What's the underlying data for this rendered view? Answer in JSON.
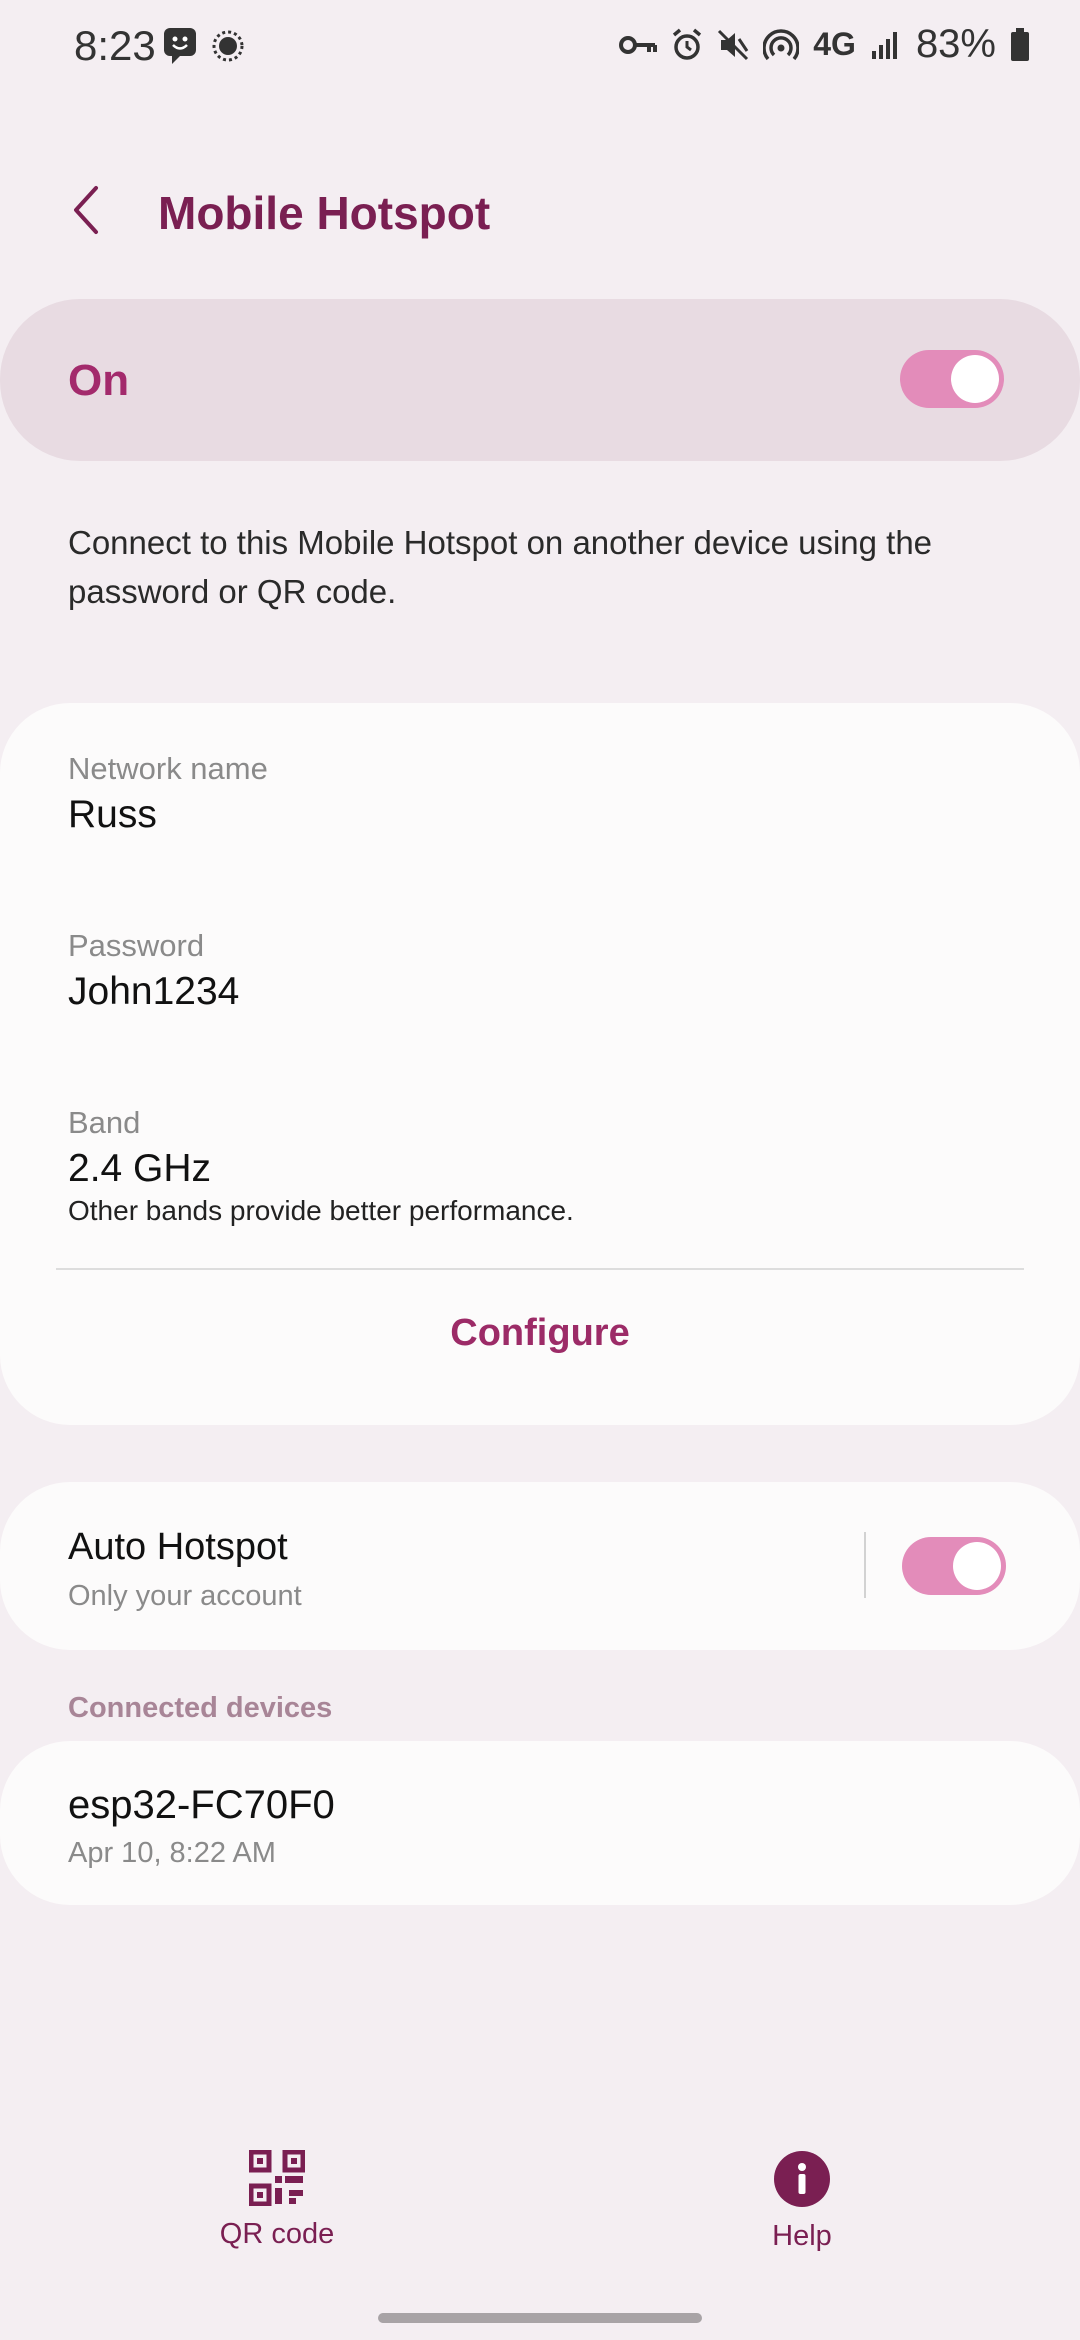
{
  "status_bar": {
    "time": "8:23",
    "network": "4G",
    "battery": "83%"
  },
  "header": {
    "title": "Mobile Hotspot"
  },
  "master_toggle": {
    "label": "On",
    "state": "on"
  },
  "description": "Connect to this Mobile Hotspot on another device using the password or QR code.",
  "network_info": {
    "network_name_label": "Network name",
    "network_name": "Russ",
    "password_label": "Password",
    "password": "John1234",
    "band_label": "Band",
    "band": "2.4 GHz",
    "band_note": "Other bands provide better performance.",
    "configure_label": "Configure"
  },
  "auto_hotspot": {
    "title": "Auto Hotspot",
    "subtitle": "Only your account",
    "state": "on"
  },
  "connected_devices": {
    "header": "Connected devices",
    "items": [
      {
        "name": "esp32-FC70F0",
        "time": "Apr 10, 8:22 AM"
      }
    ]
  },
  "bottom_bar": {
    "qr_label": "QR code",
    "help_label": "Help"
  },
  "colors": {
    "accent": "#7a1f52",
    "toggle_on": "#e38cba",
    "background": "#f4eef2"
  }
}
